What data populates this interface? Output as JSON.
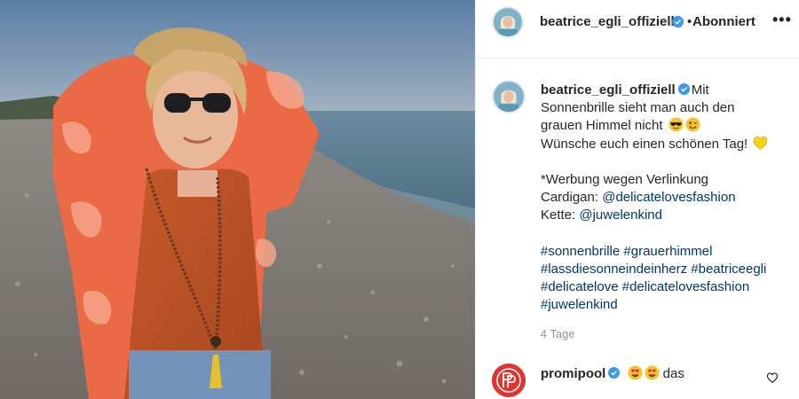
{
  "post": {
    "image_alt": "",
    "header": {
      "username": "beatrice_egli_offiziell",
      "separator": "•",
      "follow_label": "Abonniert",
      "more_label": "•••"
    },
    "caption": {
      "username": "beatrice_egli_offiziell",
      "line1_text": "Mit",
      "line2": "Sonnenbrille sieht man auch den",
      "line3_text": "grauen Himmel nicht",
      "line4_text": "Wünsche euch einen schönen Tag!",
      "line5": "*Werbung wegen Verlinkung",
      "line6_label": "Cardigan:",
      "line6_link": "@delicatelovesfashion",
      "line7_label": "Kette:",
      "line7_link": "@juwelenkind",
      "hashtags_line1": "#sonnenbrille #grauerhimmel",
      "hashtags_line2": "#lassdiesonneindeinherz #beatriceegli",
      "hashtags_line3": "#delicatelove #delicatelovesfashion",
      "hashtags_line4": "#juwelenkind"
    },
    "timestamp": "4 Tage",
    "comment": {
      "username": "promipool",
      "text": "das"
    },
    "icons": {
      "verified": "verified-badge-icon",
      "sunglasses_emoji": "sunglasses-emoji",
      "wink_emoji": "wink-emoji",
      "heart_emoji": "yellow-heart-emoji",
      "heart_eyes_emoji": "heart-eyes-emoji",
      "like": "heart-outline-icon",
      "more": "more-icon"
    },
    "colors": {
      "link": "#00376b",
      "verified": "#3897f0",
      "muted": "#8e8e8e",
      "promipool_brand": "#e0342c"
    }
  }
}
